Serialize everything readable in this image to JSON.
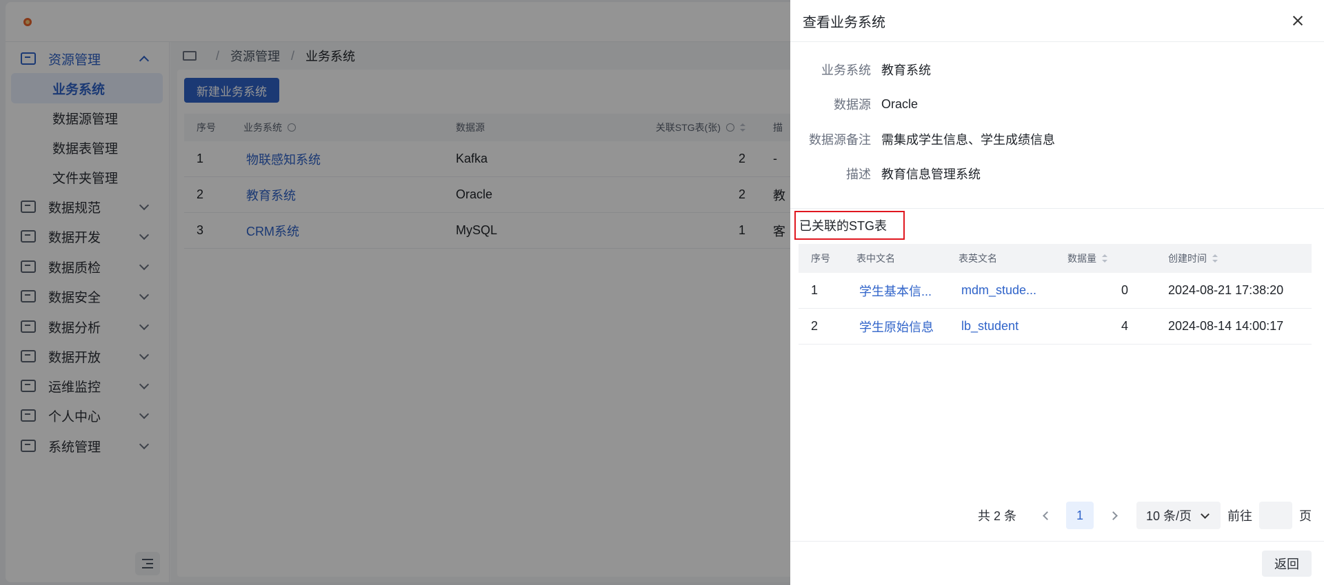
{
  "sidebar": {
    "items": [
      {
        "label": "资源管理",
        "icon": "monitor-icon",
        "open": true
      },
      {
        "label": "数据规范",
        "icon": "document-icon"
      },
      {
        "label": "数据开发",
        "icon": "code-icon"
      },
      {
        "label": "数据质检",
        "icon": "list-icon"
      },
      {
        "label": "数据安全",
        "icon": "check-screen-icon"
      },
      {
        "label": "数据分析",
        "icon": "analysis-icon"
      },
      {
        "label": "数据开放",
        "icon": "share-icon"
      },
      {
        "label": "运维监控",
        "icon": "chart-line-icon"
      },
      {
        "label": "个人中心",
        "icon": "user-icon"
      },
      {
        "label": "系统管理",
        "icon": "settings-icon"
      }
    ],
    "sub_items": [
      "业务系统",
      "数据源管理",
      "数据表管理",
      "文件夹管理"
    ]
  },
  "breadcrumb": {
    "sep": "/",
    "level1": "资源管理",
    "level2": "业务系统"
  },
  "main": {
    "new_button": "新建业务系统",
    "columns": [
      "序号",
      "业务系统",
      "数据源",
      "关联STG表(张)",
      "描"
    ],
    "rows": [
      {
        "no": "1",
        "system": "物联感知系统",
        "source": "Kafka",
        "stg": "2",
        "desc": "-"
      },
      {
        "no": "2",
        "system": "教育系统",
        "source": "Oracle",
        "stg": "2",
        "desc": "教"
      },
      {
        "no": "3",
        "system": "CRM系统",
        "source": "MySQL",
        "stg": "1",
        "desc": "客"
      }
    ]
  },
  "drawer": {
    "title": "查看业务系统",
    "fields": [
      {
        "label": "业务系统",
        "value": "教育系统"
      },
      {
        "label": "数据源",
        "value": "Oracle"
      },
      {
        "label": "数据源备注",
        "value": "需集成学生信息、学生成绩信息"
      },
      {
        "label": "描述",
        "value": "教育信息管理系统"
      }
    ],
    "section_title": "已关联的STG表",
    "columns": [
      "序号",
      "表中文名",
      "表英文名",
      "数据量",
      "创建时间"
    ],
    "rows": [
      {
        "no": "1",
        "cn": "学生基本信...",
        "en": "mdm_stude...",
        "count": "0",
        "time": "2024-08-21 17:38:20"
      },
      {
        "no": "2",
        "cn": "学生原始信息",
        "en": "lb_student",
        "count": "4",
        "time": "2024-08-14 14:00:17"
      }
    ],
    "pagination": {
      "total": "共 2 条",
      "page": "1",
      "page_size": "10 条/页",
      "goto": "前往",
      "page_unit": "页"
    },
    "back_button": "返回"
  }
}
